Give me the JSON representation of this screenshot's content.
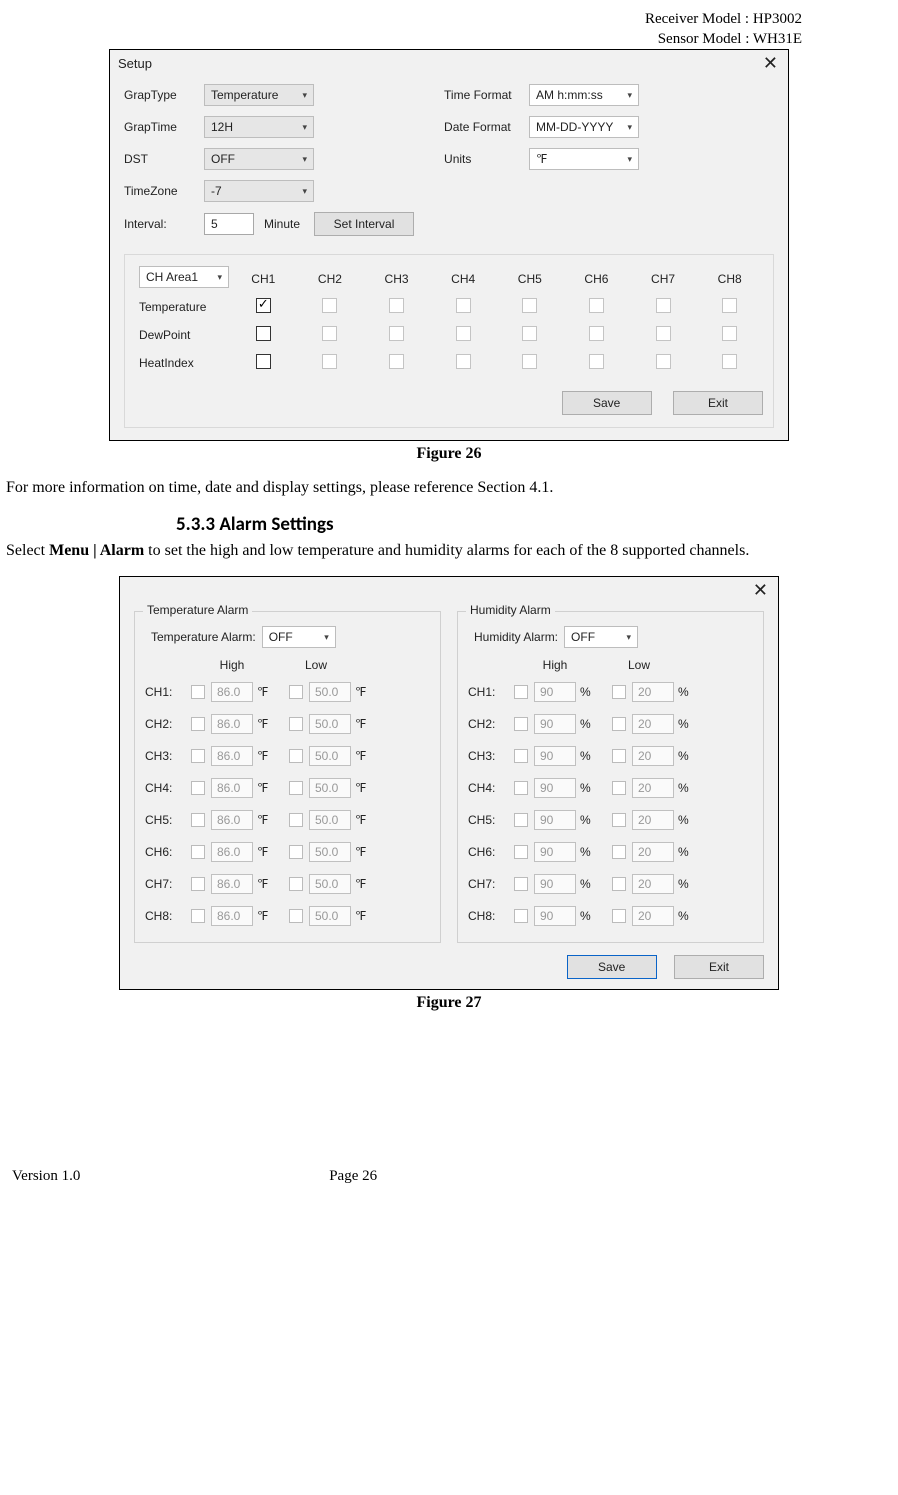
{
  "header": {
    "receiver_line": "Receiver Model : HP3002",
    "sensor_line": "Sensor Model : WH31E"
  },
  "setup_dialog": {
    "title": "Setup",
    "grap_type_label": "GrapType",
    "grap_type_value": "Temperature",
    "time_format_label": "Time Format",
    "time_format_value": "AM h:mm:ss",
    "grap_time_label": "GrapTime",
    "grap_time_value": "12H",
    "date_format_label": "Date Format",
    "date_format_value": "MM-DD-YYYY",
    "dst_label": "DST",
    "dst_value": "OFF",
    "units_label": "Units",
    "units_value": "℉",
    "timezone_label": "TimeZone",
    "timezone_value": "-7",
    "interval_label": "Interval:",
    "interval_value": "5",
    "interval_unit": "Minute",
    "set_interval_btn": "Set Interval",
    "ch_area_value": "CH Area1",
    "columns": [
      "CH1",
      "CH2",
      "CH3",
      "CH4",
      "CH5",
      "CH6",
      "CH7",
      "CH8"
    ],
    "rows": {
      "temperature": "Temperature",
      "dewpoint": "DewPoint",
      "heatindex": "HeatIndex"
    },
    "save_btn": "Save",
    "exit_btn": "Exit"
  },
  "caption_fig26": "Figure 26",
  "body_para1": "For more information on time, date and display settings, please reference Section 4.1.",
  "section_heading": "5.3.3  Alarm Settings",
  "body_para2_pre": "Select ",
  "body_para2_bold": "Menu | Alarm",
  "body_para2_post": " to set the high and low temperature and humidity alarms for each of the 8 supported channels.",
  "alarm_dialog": {
    "temp_group": "Temperature Alarm",
    "temp_alarm_label": "Temperature Alarm:",
    "temp_alarm_value": "OFF",
    "hum_group": "Humidity Alarm",
    "hum_alarm_label": "Humidity Alarm:",
    "hum_alarm_value": "OFF",
    "high_label": "High",
    "low_label": "Low",
    "temp_unit": "℉",
    "hum_unit": "%",
    "channels": [
      "CH1:",
      "CH2:",
      "CH3:",
      "CH4:",
      "CH5:",
      "CH6:",
      "CH7:",
      "CH8:"
    ],
    "temp_high": "86.0",
    "temp_low": "50.0",
    "hum_high": "90",
    "hum_low": "20",
    "save_btn": "Save",
    "exit_btn": "Exit"
  },
  "caption_fig27": "Figure 27",
  "footer": {
    "version": "Version 1.0",
    "page": "Page 26"
  }
}
